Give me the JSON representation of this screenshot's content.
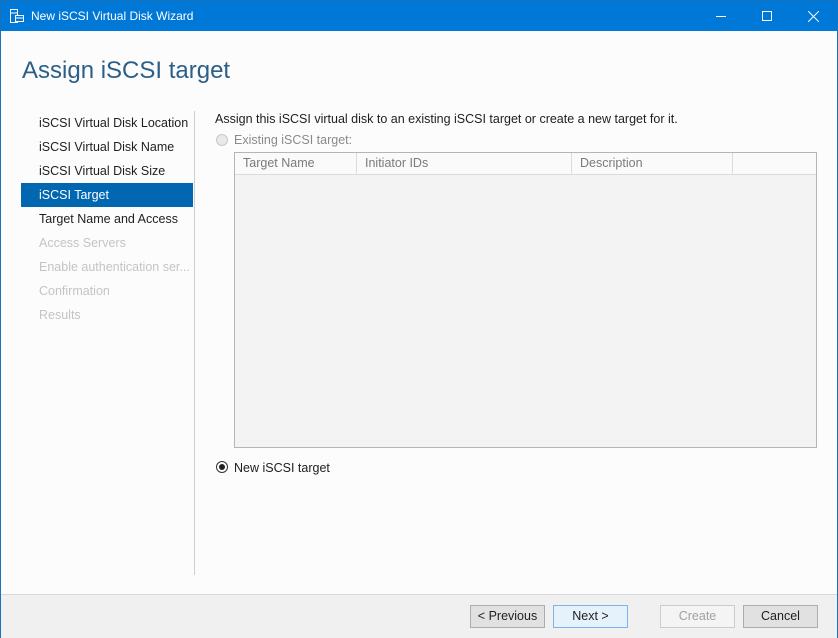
{
  "window": {
    "title": "New iSCSI Virtual Disk Wizard",
    "controls": {
      "minimize": "minimize-icon",
      "maximize": "maximize-icon",
      "close": "close-icon"
    }
  },
  "page_title": "Assign iSCSI target",
  "nav": {
    "items": [
      {
        "label": "iSCSI Virtual Disk Location",
        "state": "normal"
      },
      {
        "label": "iSCSI Virtual Disk Name",
        "state": "normal"
      },
      {
        "label": "iSCSI Virtual Disk Size",
        "state": "normal"
      },
      {
        "label": "iSCSI Target",
        "state": "active"
      },
      {
        "label": "Target Name and Access",
        "state": "normal"
      },
      {
        "label": "Access Servers",
        "state": "disabled"
      },
      {
        "label": "Enable authentication ser...",
        "state": "disabled"
      },
      {
        "label": "Confirmation",
        "state": "disabled"
      },
      {
        "label": "Results",
        "state": "disabled"
      }
    ]
  },
  "main": {
    "description": "Assign this iSCSI virtual disk to an existing iSCSI target or create a new target for it.",
    "existing_option": {
      "label": "Existing iSCSI target:",
      "selected": false,
      "enabled": false
    },
    "table": {
      "columns": [
        "Target Name",
        "Initiator IDs",
        "Description",
        ""
      ],
      "rows": []
    },
    "new_option": {
      "label": "New iSCSI target",
      "selected": true,
      "enabled": true
    }
  },
  "footer": {
    "previous": "< Previous",
    "next": "Next >",
    "create": "Create",
    "cancel": "Cancel"
  },
  "colors": {
    "titlebar": "#0078d7",
    "accent": "#0067b0",
    "page_title": "#2b5f88"
  }
}
